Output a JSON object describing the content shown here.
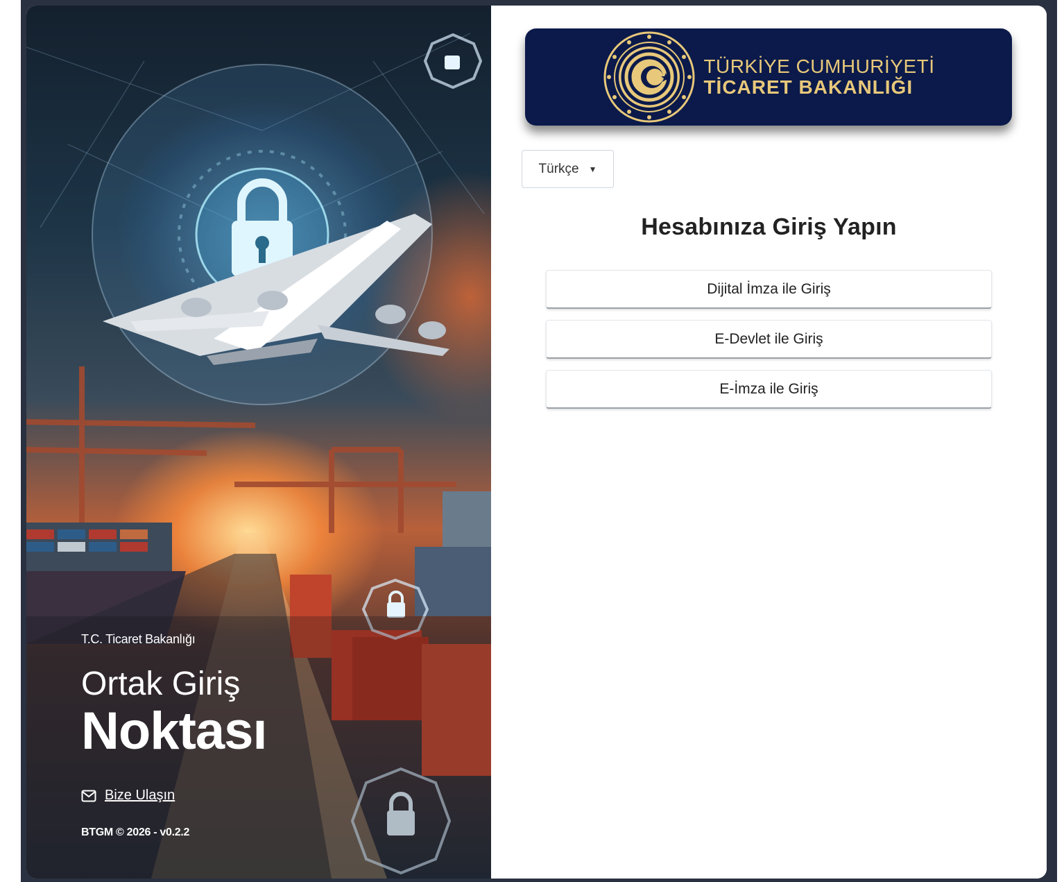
{
  "hero": {
    "org_name": "T.C. Ticaret Bakanlığı",
    "title_line1": "Ortak Giriş",
    "title_line2": "Noktası",
    "contact_label": "Bize Ulaşın",
    "copyright": "BTGM © 2026 - v0.2.2"
  },
  "banner": {
    "line1": "TÜRKİYE CUMHURİYETİ",
    "line2": "TİCARET BAKANLIĞI",
    "bg_color": "#0b1a4a",
    "text_color": "#e8c87a"
  },
  "language_select": {
    "selected": "Türkçe"
  },
  "login": {
    "heading": "Hesabınıza Giriş Yapın",
    "options": [
      {
        "label": "Dijital İmza ile Giriş"
      },
      {
        "label": "E-Devlet ile Giriş"
      },
      {
        "label": "E-İmza ile Giriş"
      }
    ]
  }
}
